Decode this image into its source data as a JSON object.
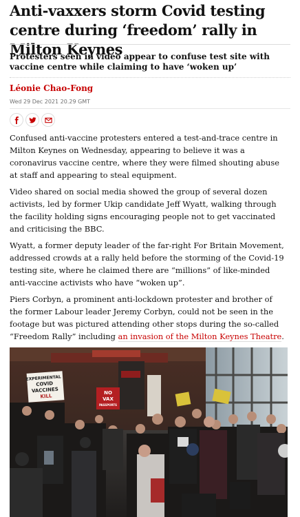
{
  "article": {
    "headline": "Anti-vaxxers storm Covid testing centre during ‘freedom’ rally in Milton Keynes",
    "standfirst": "Protesters seen in video appear to confuse test site with vaccine centre while claiming to have ‘woken up’",
    "byline": "Léonie Chao-Fong",
    "dateline": "Wed 29 Dec 2021 20.29 GMT",
    "paragraphs": {
      "p1": "Confused anti-vaccine protesters entered a test-and-trace centre in Milton Keynes on Wednesday, appearing to believe it was a coronavirus vaccine centre, where they were filmed shouting abuse at staff and appearing to steal equipment.",
      "p2": "Video shared on social media showed the group of several dozen activists, led by former Ukip candidate Jeff Wyatt, walking through the facility holding signs encouraging people not to get vaccinated and criticising the BBC.",
      "p3": "Wyatt, a former deputy leader of the far-right For Britain Movement, addressed crowds at a rally held before the storming of the Covid-19 testing site, where he claimed there are “millions” of like-minded anti-vaccine activists who have “woken up”.",
      "p4_before": "Piers Corbyn, a prominent anti-lockdown protester and brother of the former Labour leader Jeremy Corbyn, could not be seen in the footage but was pictured attending other stops during the so-called “Freedom Rally” including ",
      "p4_link": "an invasion of the Milton Keynes Theatre",
      "p4_after": "."
    }
  },
  "share": {
    "icons": [
      "facebook-icon",
      "twitter-icon",
      "email-icon"
    ]
  },
  "photo": {
    "signs": {
      "sign1_line1": "EXPERIMENTAL",
      "sign1_line2": "COVID",
      "sign1_line3": "VACCINES",
      "sign1_line4": "KILL",
      "sign2_line1": "NO",
      "sign2_line2": "VAX",
      "sign2_line3": "PASSPORTS"
    }
  },
  "colors": {
    "accent": "#c70000",
    "text": "#121212",
    "meta": "#707070"
  }
}
